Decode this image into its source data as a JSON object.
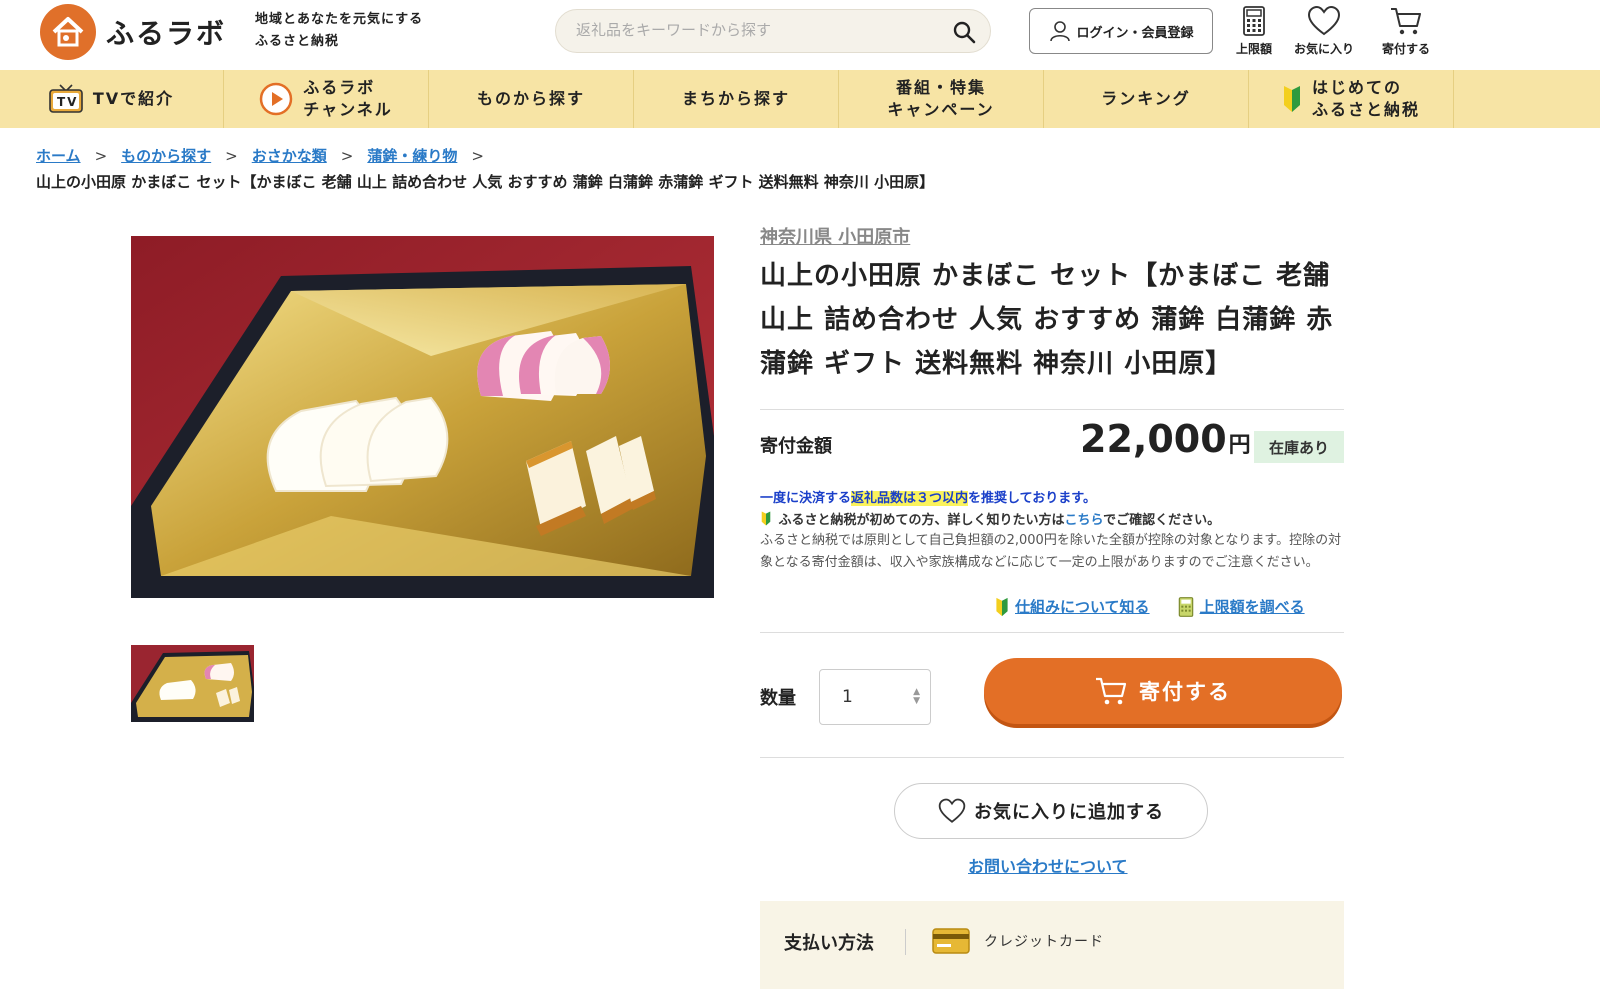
{
  "header": {
    "logo_text": "ふるラボ",
    "tagline_line1": "地域とあなたを元気にする",
    "tagline_line2": "ふるさと納税",
    "search_placeholder": "返礼品をキーワードから探す",
    "login_label": "ログイン・会員登録",
    "icons": [
      {
        "name": "calculator-icon",
        "label": "上限額"
      },
      {
        "name": "heart-icon",
        "label": "お気に入り"
      },
      {
        "name": "cart-icon",
        "label": "寄付する"
      }
    ]
  },
  "nav": {
    "items": [
      {
        "label": "TVで紹介",
        "icon": "tv-icon"
      },
      {
        "label_line1": "ふるラボ",
        "label_line2": "チャンネル",
        "icon": "play-icon"
      },
      {
        "label": "ものから探す"
      },
      {
        "label": "まちから探す"
      },
      {
        "label_line1": "番組・特集",
        "label_line2": "キャンペーン"
      },
      {
        "label": "ランキング"
      },
      {
        "label_line1": "はじめての",
        "label_line2": "ふるさと納税",
        "icon": "beginner-mark-icon"
      }
    ]
  },
  "breadcrumb": {
    "items": [
      "ホーム",
      "ものから探す",
      "おさかな類",
      "蒲鉾・練り物"
    ],
    "separator": ">",
    "current": "山上の小田原 かまぼこ セット【かまぼこ 老舗 山上 詰め合わせ 人気 おすすめ 蒲鉾 白蒲鉾 赤蒲鉾 ギフト 送料無料 神奈川 小田原】"
  },
  "product": {
    "municipality": "神奈川県 小田原市",
    "title": "山上の小田原 かまぼこ セット【かまぼこ 老舗 山上 詰め合わせ 人気 おすすめ 蒲鉾 白蒲鉾 赤蒲鉾 ギフト 送料無料 神奈川 小田原】",
    "donation_label": "寄付金額",
    "price": "22,000",
    "price_unit": "円",
    "stock": "在庫あり",
    "note1_pre": "一度に決済する",
    "note1_highlight": "返礼品数は３つ以内",
    "note1_post": "を推奨しております。",
    "note2_pre": "ふるさと納税が初めての方、詳しく知りたい方は",
    "note2_link": "こちら",
    "note2_post": "でご確認ください。",
    "note3": "ふるさと納税では原則として自己負担額の2,000円を除いた全額が控除の対象となります。控除の対象となる寄付金額は、収入や家族構成などに応じて一定の上限がありますのでご注意ください。",
    "link_mechanism": "仕組みについて知る",
    "link_limit": "上限額を調べる",
    "qty_label": "数量",
    "qty_value": "1",
    "donate_label": "寄付する",
    "fav_label": "お気に入りに追加する",
    "inquiry_label": "お問い合わせについて",
    "payment_label": "支払い方法",
    "payment_method": "クレジットカード"
  },
  "colors": {
    "accent": "#e36f26",
    "nav_bg": "#f7e4a5",
    "link": "#2a7ac7",
    "stock_bg": "#dff2e1"
  }
}
